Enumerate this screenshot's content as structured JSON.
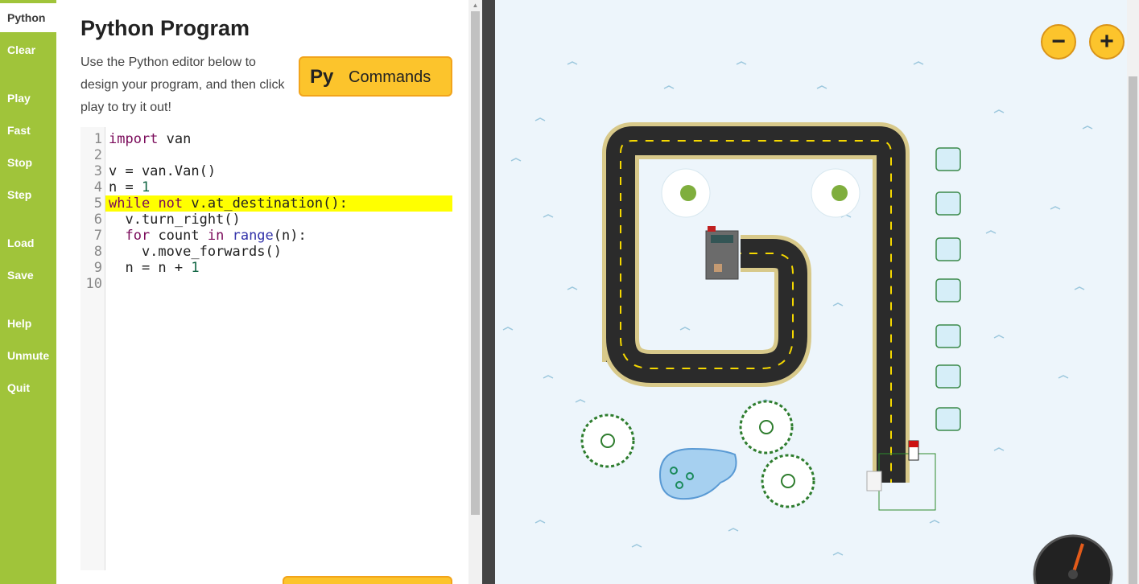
{
  "tabs": [
    {
      "label": "Python",
      "active": true
    },
    {
      "label": "Clear"
    },
    {
      "label": "Play"
    },
    {
      "label": "Fast"
    },
    {
      "label": "Stop"
    },
    {
      "label": "Step"
    },
    {
      "label": "Load"
    },
    {
      "label": "Save"
    },
    {
      "label": "Help"
    },
    {
      "label": "Unmute"
    },
    {
      "label": "Quit"
    }
  ],
  "panel": {
    "title": "Python Program",
    "description": "Use the Python editor below to design your program, and then click play to try it out!",
    "commands_icon": "Py",
    "commands_label": "Commands"
  },
  "editor": {
    "line_numbers": [
      "1",
      "2",
      "3",
      "4",
      "5",
      "6",
      "7",
      "8",
      "9",
      "10"
    ],
    "highlighted_line": 5,
    "lines": [
      "import van",
      "",
      "v = van.Van()",
      "n = 1",
      "while not v.at_destination():",
      "  v.turn_right()",
      "  for count in range(n):",
      "    v.move_forwards()",
      "  n = n + 1",
      ""
    ]
  },
  "map": {
    "zoom_out_label": "−",
    "zoom_in_label": "+",
    "background_color": "#edf5fb",
    "road_color": "#2b2b2b",
    "road_border_color": "#d8c98a",
    "lane_marking_color": "#f5d800"
  },
  "colors": {
    "tabbar": "#a0c43a",
    "accent_button": "#fcc42c",
    "highlight": "#ffff00"
  }
}
